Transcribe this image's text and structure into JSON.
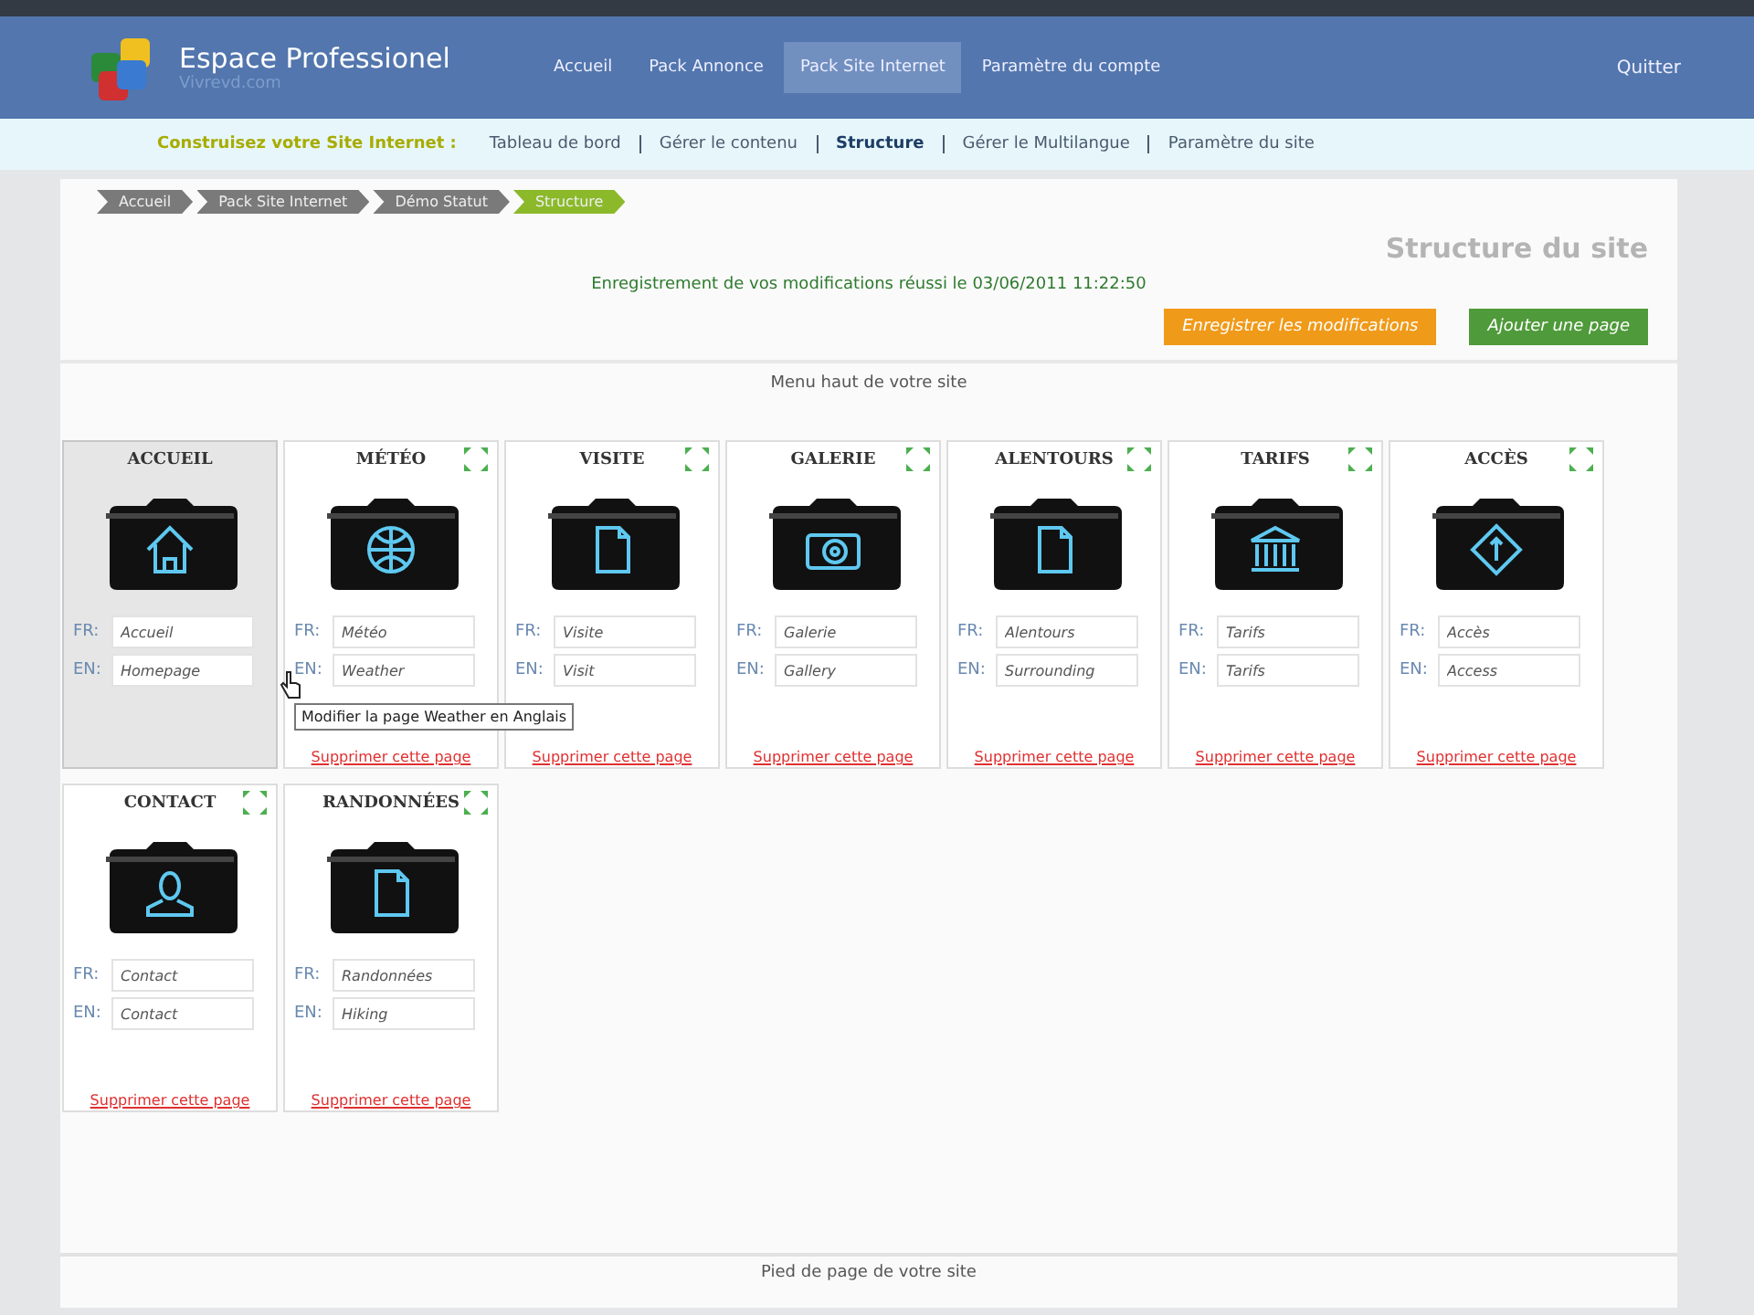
{
  "header": {
    "brand": "Espace Professionel",
    "brand_sub": "Vivrevd.com",
    "nav": [
      {
        "label": "Accueil",
        "selected": false
      },
      {
        "label": "Pack Annonce",
        "selected": false
      },
      {
        "label": "Pack Site Internet",
        "selected": true
      },
      {
        "label": "Paramètre du compte",
        "selected": false
      }
    ],
    "quit": "Quitter"
  },
  "subnav": {
    "title": "Construisez votre Site Internet :",
    "items": [
      {
        "label": "Tableau de bord",
        "selected": false
      },
      {
        "label": "Gérer le contenu",
        "selected": false
      },
      {
        "label": "Structure",
        "selected": true
      },
      {
        "label": "Gérer le Multilangue",
        "selected": false
      },
      {
        "label": "Paramètre du site",
        "selected": false
      }
    ]
  },
  "breadcrumb": [
    {
      "label": "Accueil",
      "selected": false
    },
    {
      "label": "Pack Site Internet",
      "selected": false
    },
    {
      "label": "Démo Statut",
      "selected": false
    },
    {
      "label": "Structure",
      "selected": true
    }
  ],
  "page_title": "Structure du site",
  "message": "Enregistrement de vos modifications réussi le 03/06/2011 11:22:50",
  "buttons": [
    {
      "label": "Enregistrer les modifications",
      "kind": "save"
    },
    {
      "label": "Ajouter une page",
      "kind": "add"
    }
  ],
  "top_menu_label": "Menu haut de votre site",
  "cards": [
    {
      "title": "ACCUEIL",
      "kind": "home",
      "selected": true,
      "movable": false,
      "fr_label": "FR:",
      "fr": "Accueil",
      "en_label": "EN:",
      "en": "Homepage"
    },
    {
      "title": "MÉTÉO",
      "kind": "globe",
      "selected": false,
      "movable": true,
      "fr_label": "FR:",
      "fr": "Météo",
      "en_label": "EN:",
      "en": "Weather",
      "delete": "Supprimer cette page"
    },
    {
      "title": "VISITE",
      "kind": "page",
      "selected": false,
      "movable": true,
      "fr_label": "FR:",
      "fr": "Visite",
      "en_label": "EN:",
      "en": "Visit",
      "delete": "Supprimer cette page"
    },
    {
      "title": "GALERIE",
      "kind": "camera",
      "selected": false,
      "movable": true,
      "fr_label": "FR:",
      "fr": "Galerie",
      "en_label": "EN:",
      "en": "Gallery",
      "delete": "Supprimer cette page"
    },
    {
      "title": "ALENTOURS",
      "kind": "page",
      "selected": false,
      "movable": true,
      "fr_label": "FR:",
      "fr": "Alentours",
      "en_label": "EN:",
      "en": "Surrounding",
      "delete": "Supprimer cette page"
    },
    {
      "title": "TARIFS",
      "kind": "bank",
      "selected": false,
      "movable": true,
      "fr_label": "FR:",
      "fr": "Tarifs",
      "en_label": "EN:",
      "en": "Tarifs",
      "delete": "Supprimer cette page"
    },
    {
      "title": "ACCÈS",
      "kind": "sign",
      "selected": false,
      "movable": true,
      "fr_label": "FR:",
      "fr": "Accès",
      "en_label": "EN:",
      "en": "Access",
      "delete": "Supprimer cette page"
    },
    {
      "title": "CONTACT",
      "kind": "person",
      "selected": false,
      "movable": true,
      "fr_label": "FR:",
      "fr": "Contact",
      "en_label": "EN:",
      "en": "Contact",
      "delete": "Supprimer cette page"
    },
    {
      "title": "RANDONNÉES",
      "kind": "page",
      "selected": false,
      "movable": true,
      "fr_label": "FR:",
      "fr": "Randonnées",
      "en_label": "EN:",
      "en": "Hiking",
      "delete": "Supprimer cette page"
    }
  ],
  "tooltip": "Modifier la page Weather en Anglais",
  "footer_label": "Pied de page de votre site"
}
